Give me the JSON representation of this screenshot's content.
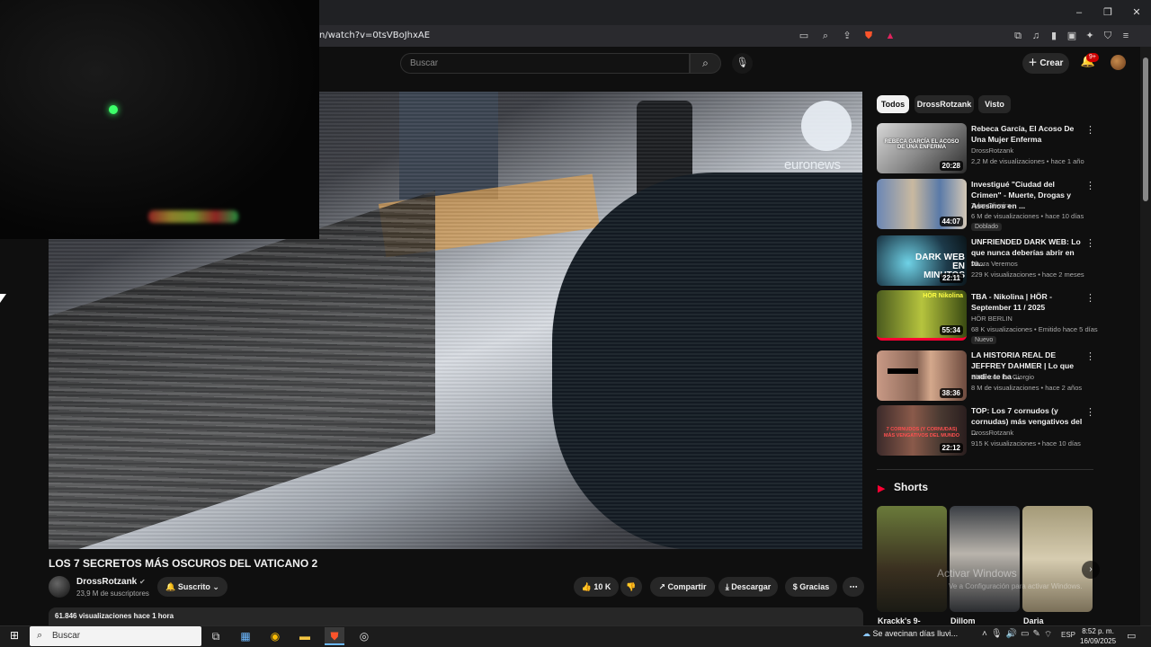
{
  "browser": {
    "url": "n/watch?v=0tsVBoJhxAE",
    "window_controls": [
      "–",
      "❐",
      "✕"
    ],
    "icons": [
      "screen-icon",
      "zoom-icon",
      "share-icon",
      "brave-shield-icon",
      "rewards-icon"
    ],
    "right_icons": [
      "tab-icon",
      "music-icon",
      "sidebar-icon",
      "wallet-icon",
      "leo-icon",
      "vpn-icon",
      "menu-icon"
    ]
  },
  "youtube": {
    "search_placeholder": "Buscar",
    "create_label": "Crear",
    "notif_badge": "9+"
  },
  "video": {
    "watermark": "euronews",
    "title": "LOS 7 SECRETOS MÁS OSCUROS DEL VATICANO 2",
    "channel": "DrossRotzank",
    "subscribers": "23,9 M de suscriptores",
    "subscribed_label": "Suscrito",
    "likes": "10 K",
    "share_label": "Compartir",
    "download_label": "Descargar",
    "thanks_label": "Gracias",
    "views_time": "61.846 visualizaciones  hace 1 hora"
  },
  "sidebar": {
    "chips": [
      "Todos",
      "DrossRotzank",
      "Visto"
    ],
    "videos": [
      {
        "title": "Rebeca García, El Acoso De Una Mujer Enferma",
        "channel": "DrossRotzank",
        "meta": "2,2 M de visualizaciones • hace 1 año",
        "duration": "20:28",
        "thumb_text": "REBECA GARCÍA EL ACOSO DE UNA ENFERMA",
        "tag": ""
      },
      {
        "title": "Investigué \"Ciudad del Crimen\" - Muerte, Drogas y Asesinos en ...",
        "channel": "Tyler Oliveira",
        "meta": "6 M de visualizaciones • hace 10 días",
        "duration": "44:07",
        "thumb_text": "",
        "tag": "Doblado"
      },
      {
        "title": "UNFRIENDED DARK WEB: Lo que nunca deberías abrir en tu...",
        "channel": "Ahora Veremos",
        "meta": "229 K visualizaciones • hace 2 meses",
        "duration": "22:11",
        "thumb_text": "DARK WEB EN MINUTOS",
        "tag": ""
      },
      {
        "title": "TBA - Nikolina | HÖR - September 11 / 2025",
        "channel": "HÖR BERLIN",
        "meta": "68 K visualizaciones • Emitido hace 5 días",
        "duration": "55:34",
        "thumb_text": "HÖR Nikolina",
        "tag": "Nuevo"
      },
      {
        "title": "LA HISTORIA REAL DE JEFFREY DAHMER | Lo que nadie te ha ...",
        "channel": "El Rincón De Giorgio",
        "meta": "8 M de visualizaciones • hace 2 años",
        "duration": "38:36",
        "thumb_text": "",
        "tag": ""
      },
      {
        "title": "TOP: Los 7 cornudos (y cornudas) más vengativos del ...",
        "channel": "DrossRotzank",
        "meta": "915 K visualizaciones • hace 10 días",
        "duration": "22:12",
        "thumb_text": "7 CORNUDOS (Y CORNUDAS) MÁS VENGATIVOS DEL MUNDO",
        "tag": ""
      }
    ],
    "shorts_label": "Shorts",
    "shorts": [
      "Krackk's 9-",
      "Dillom",
      "Daria"
    ],
    "activate_title": "Activar Windows",
    "activate_sub": "Ve a Configuración para activar Windows."
  },
  "taskbar": {
    "search_placeholder": "Buscar",
    "weather": "Se avecinan días lluvi...",
    "lang": "ESP",
    "time": "8:52 p. m.",
    "date": "16/09/2025"
  },
  "colors": {
    "accent_red": "#ff0033",
    "badge": "#cc0000",
    "bg": "#0f0f0f"
  }
}
